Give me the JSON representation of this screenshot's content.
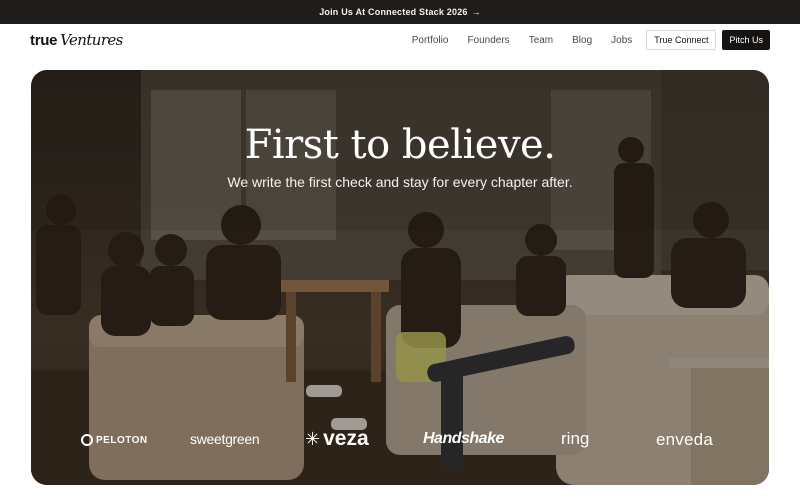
{
  "announcement": {
    "text": "Join Us At Connected Stack 2026",
    "arrow": "→"
  },
  "header": {
    "logo_primary": "true",
    "logo_script": "Ventures",
    "nav": [
      "Portfolio",
      "Founders",
      "Team",
      "Blog",
      "Jobs"
    ],
    "connect_label": "True Connect",
    "pitch_label": "Pitch Us"
  },
  "hero": {
    "title": "First to believe.",
    "subtitle": "We write the first check and stay for every chapter after.",
    "image": "audience-watching-presentation"
  },
  "portfolio_logos": [
    "PELOTON",
    "sweetgreen",
    "veza",
    "Handshake",
    "ring",
    "enveda"
  ],
  "colors": {
    "announce_bg": "#1f1d1b",
    "pitch_bg": "#161412",
    "hero_overlay": "#2c2620",
    "text_white": "#ffffff"
  }
}
